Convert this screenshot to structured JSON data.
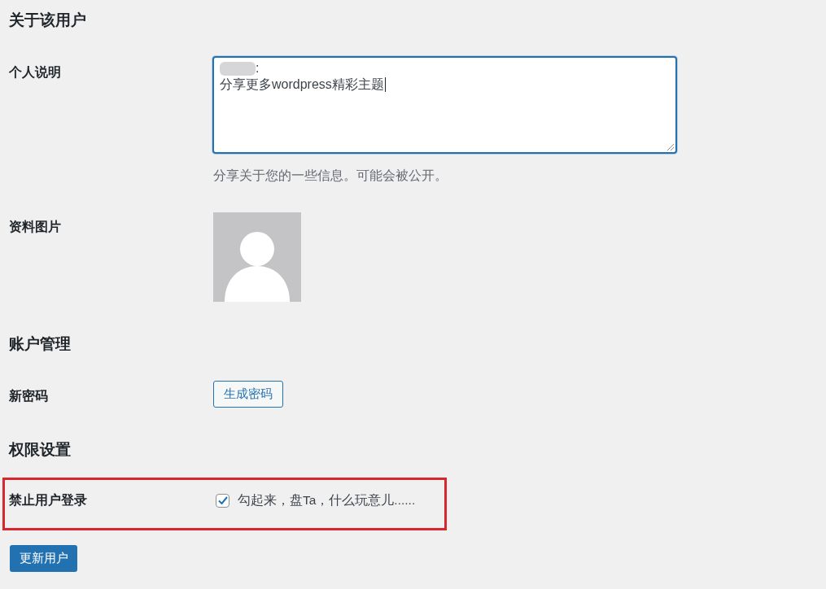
{
  "sections": [
    {
      "heading": "关于该用户",
      "rows": [
        {
          "kind": "bio",
          "label": "个人说明",
          "focused": true,
          "lines": [
            {
              "redacted": true,
              "text": ":"
            },
            {
              "redacted": false,
              "text": "分享更多wordpress精彩主题"
            }
          ],
          "description": "分享关于您的一些信息。可能会被公开。"
        },
        {
          "kind": "avatar",
          "label": "资料图片"
        }
      ]
    },
    {
      "heading": "账户管理",
      "rows": [
        {
          "kind": "button",
          "label": "新密码",
          "button": "生成密码"
        }
      ]
    },
    {
      "heading": "权限设置",
      "rows": [
        {
          "kind": "checkbox",
          "label": "禁止用户登录",
          "highlighted": true,
          "checked": true,
          "text": "勾起来，盘Ta，什么玩意儿......"
        }
      ]
    }
  ],
  "submit": "更新用户"
}
